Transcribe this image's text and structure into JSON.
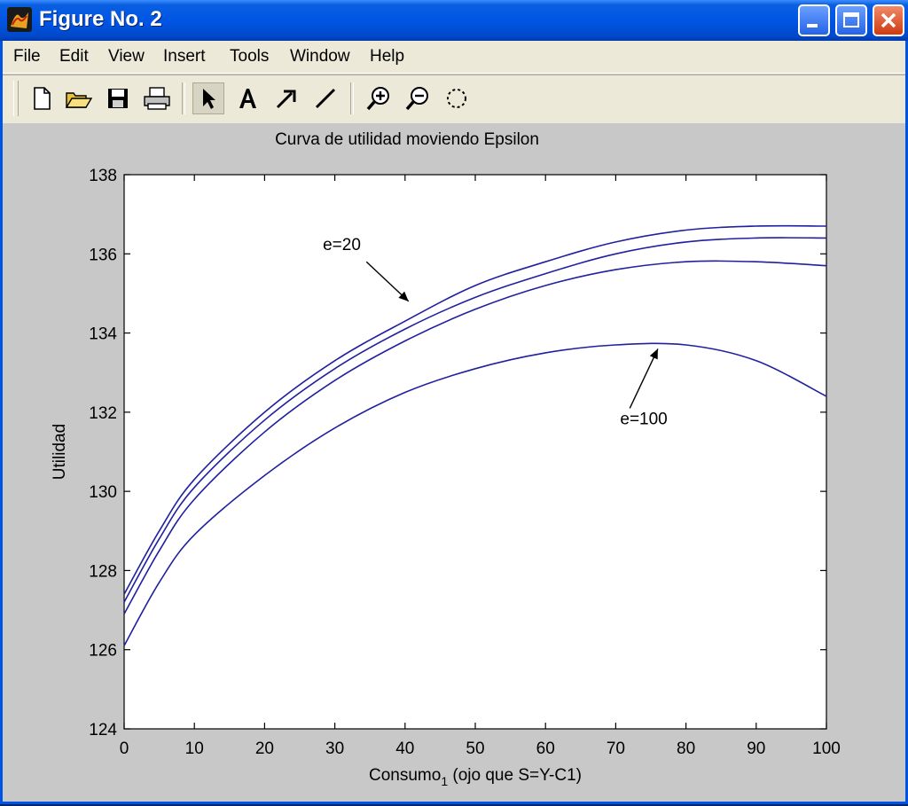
{
  "window": {
    "title": "Figure No. 2",
    "icon": "matlab-icon",
    "controls": [
      "minimize-icon",
      "maximize-icon",
      "close-icon"
    ]
  },
  "menu": {
    "file": "File",
    "edit": "Edit",
    "view": "View",
    "insert": "Insert",
    "tools": "Tools",
    "window": "Window",
    "help": "Help"
  },
  "toolbar": {
    "tools": [
      "new-file-icon",
      "open-folder-icon",
      "save-icon",
      "print-icon",
      "select-arrow-icon",
      "text-tool-icon",
      "arrow-tool-icon",
      "line-tool-icon",
      "zoom-in-icon",
      "zoom-out-icon",
      "rotate-icon"
    ],
    "pressed": "select-arrow-icon"
  },
  "chart_data": {
    "type": "line",
    "title": "Curva de utilidad moviendo Epsilon",
    "xlabel": "Consumo",
    "xlabel_sub": "1",
    "xlabel_tail": " (ojo que S=Y-C1)",
    "ylabel": "Utilidad",
    "xlim": [
      0,
      100
    ],
    "ylim": [
      124,
      138
    ],
    "xticks": [
      "0",
      "10",
      "20",
      "30",
      "40",
      "50",
      "60",
      "70",
      "80",
      "90",
      "100"
    ],
    "yticks": [
      "124",
      "126",
      "128",
      "130",
      "132",
      "134",
      "136",
      "138"
    ],
    "line_color": "#2020a0",
    "x": [
      0,
      5,
      10,
      20,
      30,
      40,
      50,
      60,
      70,
      80,
      90,
      100
    ],
    "series": [
      {
        "values": [
          127.4,
          129.0,
          130.3,
          132.0,
          133.3,
          134.3,
          135.2,
          135.8,
          136.3,
          136.6,
          136.7,
          136.7
        ]
      },
      {
        "values": [
          127.2,
          128.8,
          130.1,
          131.8,
          133.1,
          134.1,
          134.9,
          135.5,
          136.0,
          136.3,
          136.4,
          136.4
        ]
      },
      {
        "values": [
          126.9,
          128.5,
          129.8,
          131.5,
          132.8,
          133.8,
          134.6,
          135.2,
          135.6,
          135.8,
          135.8,
          135.7
        ]
      },
      {
        "values": [
          126.1,
          127.7,
          128.9,
          130.4,
          131.6,
          132.5,
          133.1,
          133.5,
          133.7,
          133.7,
          133.3,
          132.4
        ]
      }
    ],
    "annotations": [
      {
        "text": "e=20",
        "x": 31,
        "y": 136.1,
        "arrow_from": [
          34.5,
          135.8
        ],
        "arrow_to": [
          40.5,
          134.8
        ]
      },
      {
        "text": "e=100",
        "x": 74,
        "y": 131.7,
        "arrow_from": [
          72,
          132.1
        ],
        "arrow_to": [
          76,
          133.6
        ]
      }
    ],
    "grid": false
  }
}
